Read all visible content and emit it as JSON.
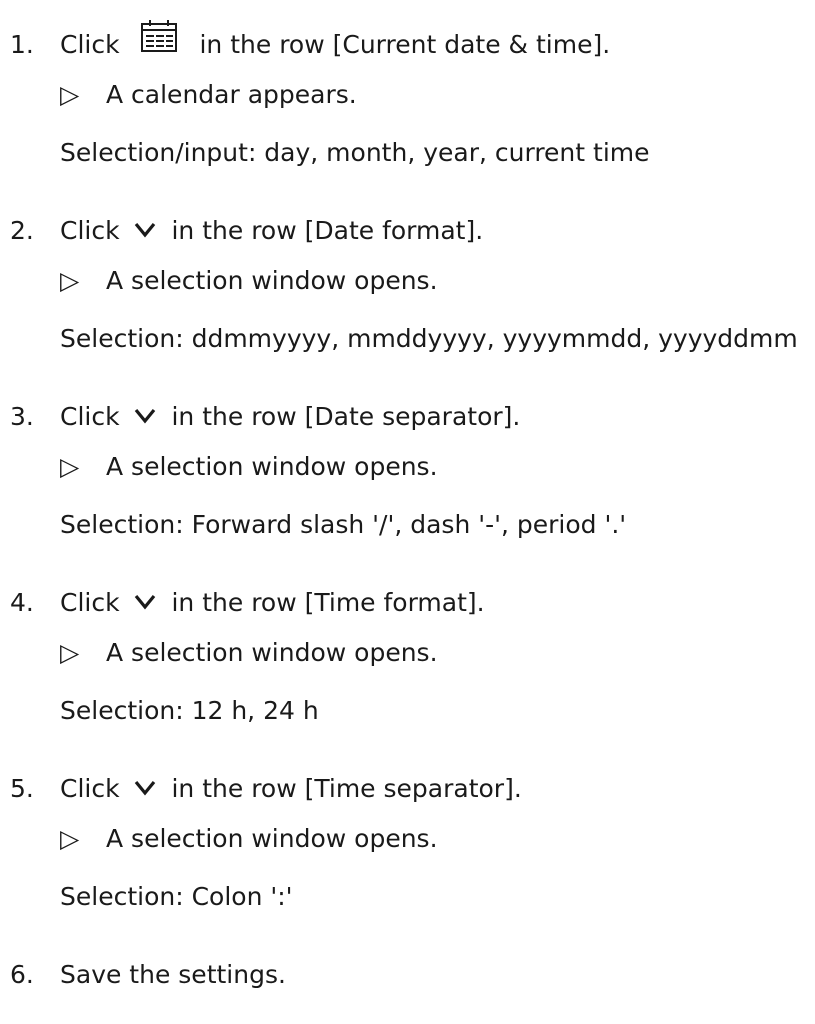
{
  "steps": [
    {
      "number": "1.",
      "pre": "Click",
      "icon": "calendar-icon",
      "post": "in the row [Current date & time].",
      "result": "A calendar appears.",
      "detail": "Selection/input: day, month, year, current time"
    },
    {
      "number": "2.",
      "pre": "Click",
      "icon": "chevron-down-icon",
      "post": "in the row [Date format].",
      "result": "A selection window opens.",
      "detail": "Selection: ddmmyyyy, mmddyyyy, yyyymmdd, yyyyddmm"
    },
    {
      "number": "3.",
      "pre": "Click",
      "icon": "chevron-down-icon",
      "post": "in the row [Date separator].",
      "result": "A selection window opens.",
      "detail": "Selection: Forward slash '/', dash '-', period '.'"
    },
    {
      "number": "4.",
      "pre": "Click",
      "icon": "chevron-down-icon",
      "post": "in the row [Time format].",
      "result": "A selection window opens.",
      "detail": "Selection: 12 h, 24 h"
    },
    {
      "number": "5.",
      "pre": "Click",
      "icon": "chevron-down-icon",
      "post": "in the row [Time separator].",
      "result": "A selection window opens.",
      "detail": "Selection: Colon ':'"
    },
    {
      "number": "6.",
      "text": "Save the settings."
    }
  ],
  "result_marker": "▷"
}
